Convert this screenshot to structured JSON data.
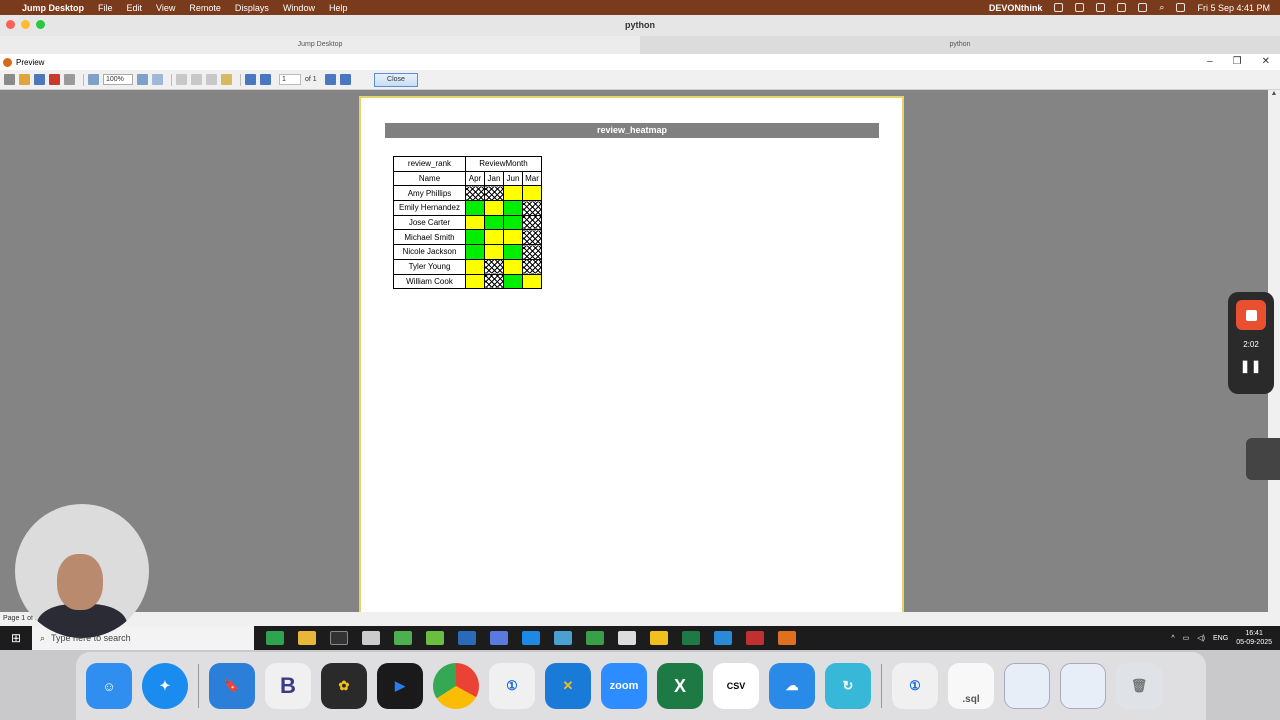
{
  "menubar": {
    "app_name": "Jump Desktop",
    "items": [
      "File",
      "Edit",
      "View",
      "Remote",
      "Displays",
      "Window",
      "Help"
    ],
    "devonthink": "DEVONthink",
    "datetime": "Fri 5 Sep  4:41 PM"
  },
  "window": {
    "title": "python",
    "tabs": [
      "Jump Desktop",
      "python"
    ]
  },
  "preview": {
    "title": "Preview",
    "zoom": "100%",
    "page_number": "1",
    "page_of": "of 1",
    "close_label": "Close",
    "status": "Page 1 of 1"
  },
  "report": {
    "title": "review_heatmap",
    "corner_label": "review_rank",
    "group_header": "ReviewMonth",
    "name_header": "Name",
    "months": [
      "Apr",
      "Jan",
      "Jun",
      "Mar"
    ],
    "rows": [
      {
        "name": "Amy Phillips",
        "cells": [
          "hatch",
          "hatch",
          "yellow",
          "yellow"
        ]
      },
      {
        "name": "Emily Hernandez",
        "cells": [
          "green",
          "yellow",
          "green",
          "hatch"
        ]
      },
      {
        "name": "Jose Carter",
        "cells": [
          "yellow",
          "green",
          "green",
          "hatch"
        ]
      },
      {
        "name": "Michael Smith",
        "cells": [
          "green",
          "yellow",
          "yellow",
          "hatch"
        ]
      },
      {
        "name": "Nicole Jackson",
        "cells": [
          "green",
          "yellow",
          "green",
          "hatch"
        ]
      },
      {
        "name": "Tyler Young",
        "cells": [
          "yellow",
          "hatch",
          "yellow",
          "hatch"
        ]
      },
      {
        "name": "William Cook",
        "cells": [
          "yellow",
          "hatch",
          "green",
          "yellow"
        ]
      }
    ]
  },
  "colors": {
    "green": "#00ee00",
    "yellow": "#ffff00",
    "title_bar": "#808080",
    "menubar": "#7a3a1c"
  },
  "taskbar": {
    "search_placeholder": "Type here to search",
    "language": "ENG",
    "time": "16:41",
    "date": "05-09-2025"
  },
  "recorder": {
    "time": "2:02"
  },
  "dock": {
    "items": [
      "finder-icon",
      "safari-icon",
      "bookmarks-icon",
      "bbedit-icon",
      "notes-icon",
      "jump-desktop-icon",
      "chrome-icon",
      "1password-icon",
      "tools-icon",
      "zoom-icon",
      "excel-icon",
      "csv-editor-icon",
      "cloud-icon",
      "sync-icon",
      "1password-icon",
      "sql-file-icon",
      "screenshot-icon",
      "screenshot-icon",
      "trash-icon"
    ],
    "zoom_label": "zoom",
    "csv_label": "CSV",
    "sql_label": ".sql",
    "excel_label": "X",
    "bbedit_label": "B"
  }
}
